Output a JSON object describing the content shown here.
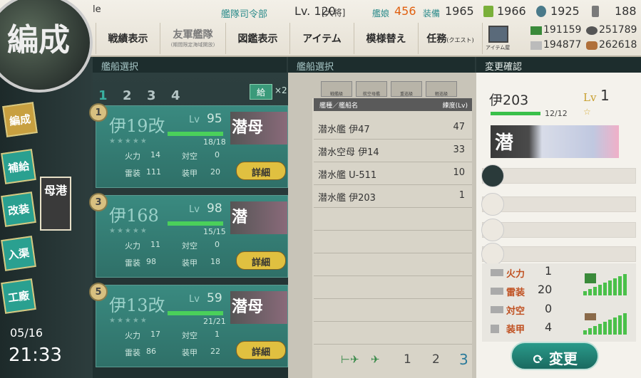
{
  "topbar": {
    "name_field": "le",
    "hq_label": "艦隊司令部",
    "hq_level": "Lv. 120",
    "hq_rank": "[大将]",
    "ships_label": "艦娘",
    "ships_count": "456",
    "equip_label": "装備",
    "equip_count": "1965",
    "bucket": "1966",
    "devmat": "1925",
    "screw": "188"
  },
  "menu": {
    "record": "戦績表示",
    "friend": "友軍艦隊",
    "friend_sub": "(期間限定海域開放)",
    "album": "図鑑表示",
    "item": "アイテム",
    "remodel": "模様替え",
    "quest": "任務",
    "quest_sub": "(クエスト)",
    "akashi": "アイテム屋"
  },
  "resources": {
    "fuel": "191159",
    "ammo": "251789",
    "steel": "194877",
    "bauxite": "262618"
  },
  "strips": {
    "left": "艦船選択",
    "middle": "艦船選択",
    "right": "変更確認"
  },
  "sidebar": {
    "logo": "編成",
    "fleet": "編成",
    "supply": "補給",
    "remodel": "改装",
    "docking": "入渠",
    "arsenal": "工廠",
    "port": "母港",
    "date": "05/16",
    "time": "21:33"
  },
  "fleet_tabs": [
    "1",
    "2",
    "3",
    "4"
  ],
  "supply_btn": "給",
  "supply_x": "×2",
  "cards": [
    {
      "slot": "1",
      "name": "伊19改",
      "lv_label": "Lv",
      "lv": "95",
      "hp": "18/18",
      "type": "潜母",
      "fire_l": "火力",
      "fire": "14",
      "aa_l": "対空",
      "aa": "0",
      "torp_l": "雷装",
      "torp": "111",
      "armor_l": "装甲",
      "armor": "20",
      "detail": "詳細"
    },
    {
      "slot": "3",
      "name": "伊168",
      "lv_label": "Lv",
      "lv": "98",
      "hp": "15/15",
      "type": "潜",
      "fire_l": "火力",
      "fire": "11",
      "aa_l": "対空",
      "aa": "0",
      "torp_l": "雷装",
      "torp": "98",
      "armor_l": "装甲",
      "armor": "18",
      "detail": "詳細"
    },
    {
      "slot": "5",
      "name": "伊13改",
      "lv_label": "Lv",
      "lv": "59",
      "hp": "21/21",
      "type": "潜母",
      "fire_l": "火力",
      "fire": "17",
      "aa_l": "対空",
      "aa": "1",
      "torp_l": "雷装",
      "torp": "86",
      "armor_l": "装甲",
      "armor": "22",
      "detail": "詳細"
    }
  ],
  "list": {
    "tabs": [
      "戦艦級",
      "航空母艦",
      "重巡級",
      "軽巡級"
    ],
    "header_left": "艦種／艦船名",
    "header_right": "練度(Lv)",
    "rows": [
      {
        "name": "潜水艦 伊47",
        "lv": "47"
      },
      {
        "name": "潜水空母 伊14",
        "lv": "33"
      },
      {
        "name": "潜水艦 U-511",
        "lv": "10"
      },
      {
        "name": "潜水艦 伊203",
        "lv": "1"
      }
    ],
    "pages": [
      "1",
      "2",
      "3"
    ],
    "pager_first": "⊢✈",
    "pager_prev": "✈"
  },
  "detail": {
    "name": "伊203",
    "lv_label": "Lv",
    "lv": "1",
    "hp": "12/12",
    "star": "☆",
    "type": "潜",
    "stats": [
      {
        "label": "火力",
        "value": "1"
      },
      {
        "label": "雷装",
        "value": "20"
      },
      {
        "label": "対空",
        "value": "0"
      },
      {
        "label": "装甲",
        "value": "4"
      }
    ],
    "confirm": "変更"
  }
}
